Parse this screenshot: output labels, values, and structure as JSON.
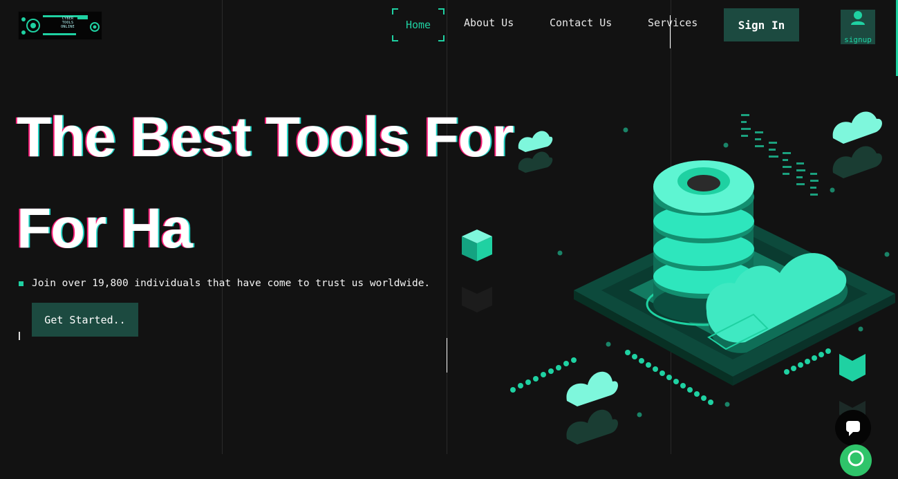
{
  "logo": {
    "text": [
      "CYBER",
      "TOOLS",
      "ONLINE"
    ]
  },
  "nav": {
    "home": "Home",
    "about": "About Us",
    "contact": "Contact Us",
    "services": "Services",
    "signin": "Sign In",
    "signup": "signup"
  },
  "hero": {
    "line1": "The Best Tools For",
    "line2": "For Ha",
    "subtext": "Join over 19,800 individuals that have come to trust us worldwide.",
    "cta": "Get Started.."
  },
  "colors": {
    "background": "#121212",
    "accent": "#1fd1a2",
    "button": "#1c4a40",
    "glitch_red": "#ff1f7a"
  },
  "icons": [
    "user-icon",
    "chat-icon",
    "whatsapp-icon"
  ]
}
